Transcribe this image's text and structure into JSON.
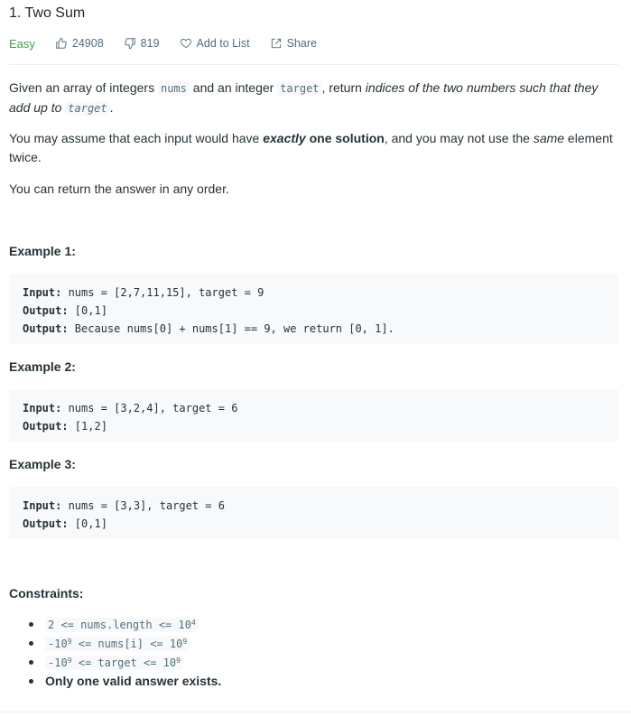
{
  "problem": {
    "title": "1. Two Sum",
    "difficulty": "Easy",
    "likes": "24908",
    "dislikes": "819",
    "add_to_list": "Add to List",
    "share": "Share"
  },
  "description": {
    "p1": {
      "t1": "Given an array of integers ",
      "c1": "nums",
      "t2": " and an integer ",
      "c2": "target",
      "t3": ", return ",
      "em": "indices of the two numbers such that they add up to ",
      "c3": "target",
      "t4": "."
    },
    "p2": {
      "t1": "You may assume that each input would have ",
      "em": "exactly",
      "strong": " one solution",
      "t2": ", and you may not use the ",
      "em2": "same",
      "t3": " element twice."
    },
    "p3": "You can return the answer in any order."
  },
  "examples": [
    {
      "title": "Example 1:",
      "input_label": "Input:",
      "input": " nums = [2,7,11,15], target = 9",
      "output_label": "Output:",
      "output": " [0,1]",
      "expl_label": "Output:",
      "expl": " Because nums[0] + nums[1] == 9, we return [0, 1]."
    },
    {
      "title": "Example 2:",
      "input_label": "Input:",
      "input": " nums = [3,2,4], target = 6",
      "output_label": "Output:",
      "output": " [1,2]"
    },
    {
      "title": "Example 3:",
      "input_label": "Input:",
      "input": " nums = [3,3], target = 6",
      "output_label": "Output:",
      "output": " [0,1]"
    }
  ],
  "constraints": {
    "title": "Constraints:",
    "c1": {
      "a": "2 <= nums.length <= 10",
      "sup": "4"
    },
    "c2": {
      "a": "-10",
      "sup1": "9",
      "b": " <= nums[i] <= 10",
      "sup2": "9"
    },
    "c3": {
      "a": "-10",
      "sup1": "9",
      "b": " <= target <= 10",
      "sup2": "9"
    },
    "c4": "Only one valid answer exists."
  },
  "icons": {
    "like": "thumbs-up-icon",
    "dislike": "thumbs-down-icon",
    "add": "heart-icon",
    "share": "share-icon"
  },
  "colors": {
    "easy": "#43a047",
    "muted": "#546e7a",
    "code_bg": "#f7f9fa"
  }
}
